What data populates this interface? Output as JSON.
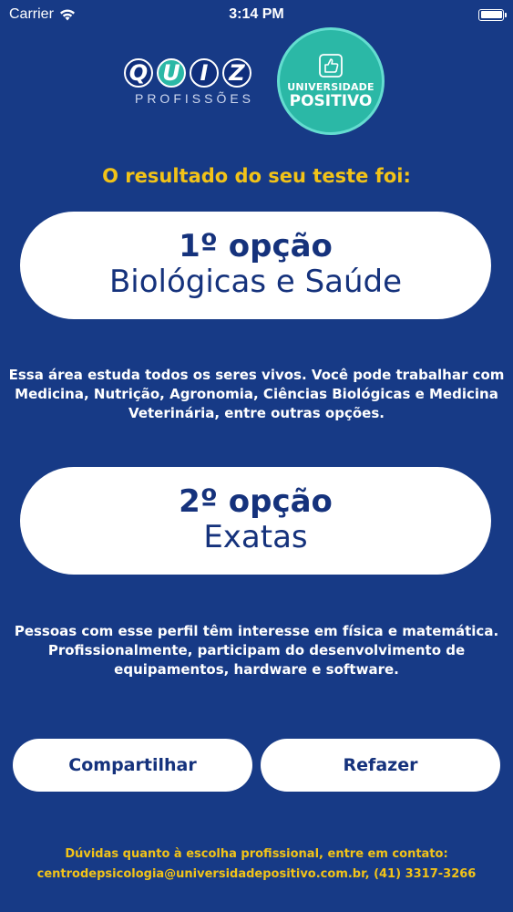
{
  "status_bar": {
    "carrier": "Carrier",
    "time": "3:14 PM",
    "battery_level": 1.0
  },
  "logos": {
    "quiz_letters": [
      "Q",
      "U",
      "I",
      "Z"
    ],
    "quiz_subtitle": "PROFISSÕES",
    "university_line1": "UNIVERSIDADE",
    "university_line2": "POSITIVO"
  },
  "result": {
    "heading": "O resultado do seu teste foi:",
    "option1": {
      "rank": "1º opção",
      "area": "Biológicas e Saúde",
      "description": "Essa área estuda todos os seres vivos. Você pode trabalhar com Medicina, Nutrição, Agronomia, Ciências Biológicas e Medicina Veterinária, entre outras opções."
    },
    "option2": {
      "rank": "2º opção",
      "area": "Exatas",
      "description": "Pessoas com esse perfil têm interesse em física e matemática. Profissionalmente, participam do desenvolvimento de equipamentos, hardware e software."
    }
  },
  "actions": {
    "share_label": "Compartilhar",
    "redo_label": "Refazer"
  },
  "contact": {
    "line1": "Dúvidas quanto à escolha profissional, entre em contato:",
    "line2": "centrodepsicologia@universidadepositivo.com.br, (41) 3317-3266"
  },
  "colors": {
    "background": "#173a86",
    "accent_yellow": "#f2c318",
    "teal": "#2bb8a6",
    "text_dark_blue": "#15327c"
  }
}
